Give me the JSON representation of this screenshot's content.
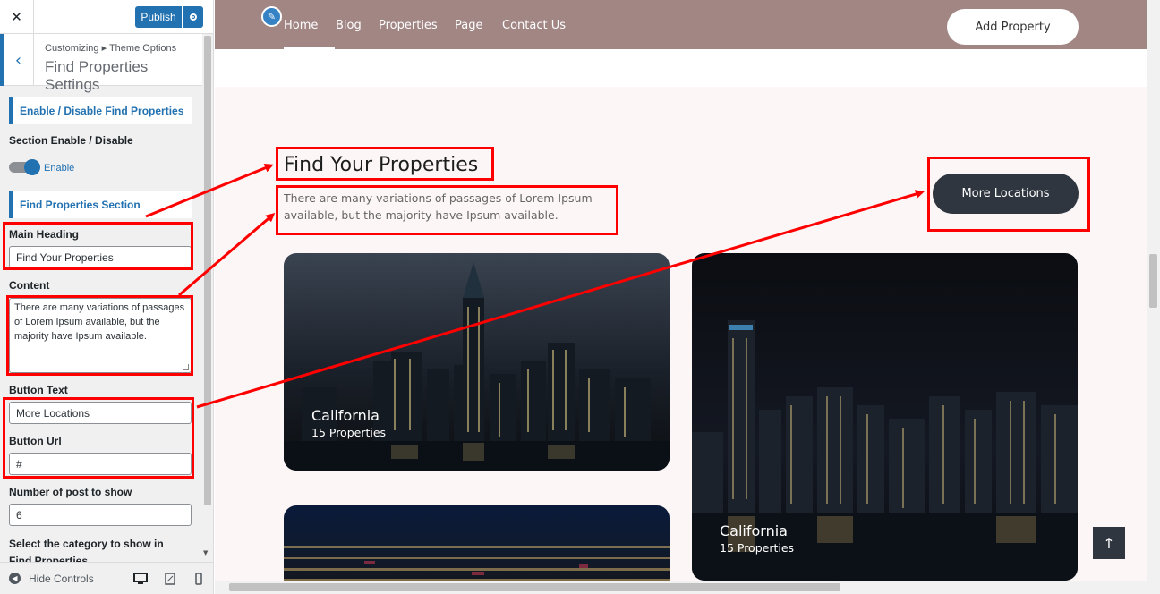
{
  "customizer": {
    "close_icon": "close-icon",
    "publish_label": "Publish",
    "breadcrumb": "Customizing ▸ Theme Options",
    "panel_title": "Find Properties Settings",
    "section1_title": "Enable / Disable Find Properties",
    "enable_label": "Section Enable / Disable",
    "toggle_text": "Enable",
    "section2_title": "Find Properties Section",
    "main_heading_label": "Main Heading",
    "main_heading_value": "Find Your Properties",
    "content_label": "Content",
    "content_value": "There are many variations of passages of Lorem Ipsum available, but the majority have Ipsum available.",
    "button_text_label": "Button Text",
    "button_text_value": "More Locations",
    "button_url_label": "Button Url",
    "button_url_value": "#",
    "num_posts_label": "Number of post to show",
    "num_posts_value": "6",
    "category_label": "Select the category to show in Find Properties",
    "hide_controls": "Hide Controls"
  },
  "preview": {
    "nav": [
      "Home",
      "Blog",
      "Properties",
      "Page",
      "Contact Us"
    ],
    "add_property": "Add Property",
    "heading": "Find Your Properties",
    "content": "There are many variations of passages of Lorem Ipsum available, but the majority have Ipsum available.",
    "more_locations": "More Locations",
    "cards": [
      {
        "title": "California",
        "subtitle": "15 Properties"
      },
      {
        "title": "California",
        "subtitle": "15 Properties"
      }
    ],
    "back_to_top_icon": "arrow-up-icon"
  },
  "colors": {
    "wp_blue": "#2271b1",
    "nav_bg": "#a18684",
    "highlight": "#ff0000",
    "dark_button": "#2f3640"
  }
}
